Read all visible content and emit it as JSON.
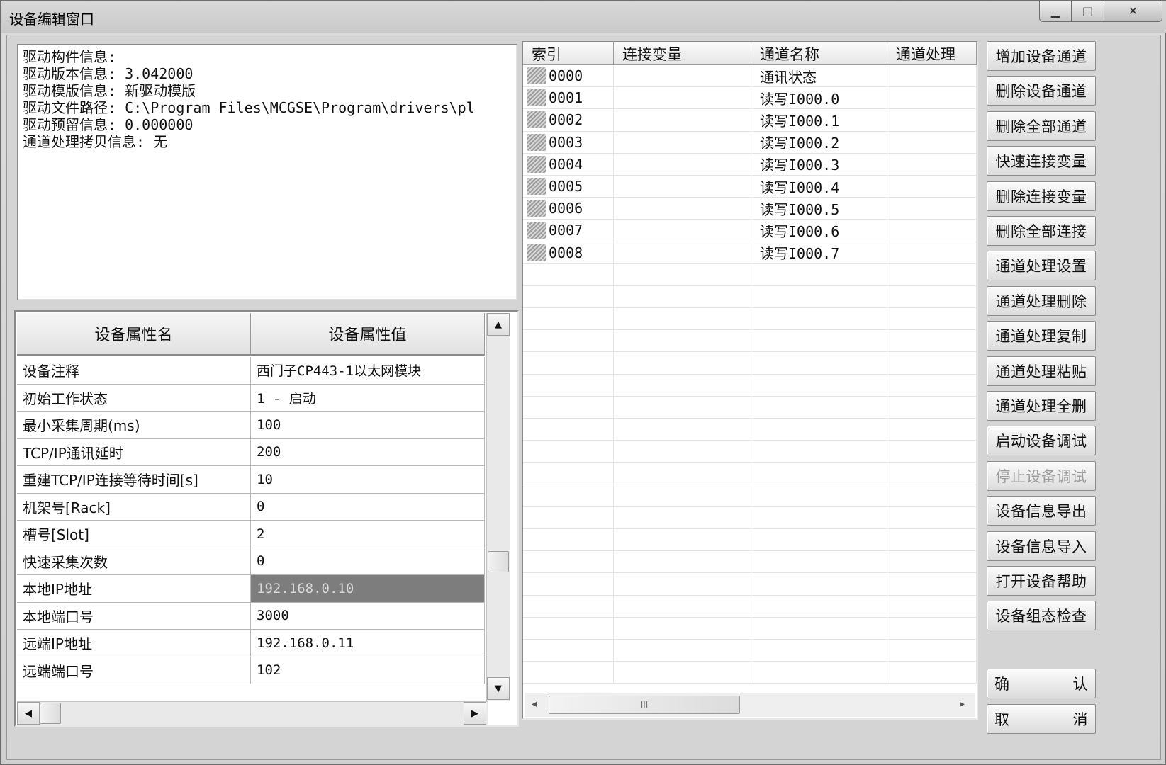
{
  "window": {
    "title": "设备编辑窗口",
    "controls": {
      "minimize": "▁",
      "maximize": "□",
      "close": "✕"
    }
  },
  "info": {
    "lines": [
      "驱动构件信息:",
      "驱动版本信息: 3.042000",
      "驱动模版信息: 新驱动模版",
      "驱动文件路径: C:\\Program Files\\MCGSE\\Program\\drivers\\pl",
      "驱动预留信息: 0.000000",
      "通道处理拷贝信息: 无"
    ]
  },
  "properties": {
    "headers": {
      "name": "设备属性名",
      "value": "设备属性值"
    },
    "rows": [
      {
        "name": "设备注释",
        "value": "西门子CP443-1以太网模块"
      },
      {
        "name": "初始工作状态",
        "value": "1 - 启动"
      },
      {
        "name": "最小采集周期(ms)",
        "value": "100"
      },
      {
        "name": "TCP/IP通讯延时",
        "value": "200"
      },
      {
        "name": "重建TCP/IP连接等待时间[s]",
        "value": "10"
      },
      {
        "name": "机架号[Rack]",
        "value": "0"
      },
      {
        "name": "槽号[Slot]",
        "value": "2"
      },
      {
        "name": "快速采集次数",
        "value": "0"
      },
      {
        "name": "本地IP地址",
        "value": "192.168.0.10"
      },
      {
        "name": "本地端口号",
        "value": "3000"
      },
      {
        "name": "远端IP地址",
        "value": "192.168.0.11"
      },
      {
        "name": "远端端口号",
        "value": "102"
      }
    ],
    "selected_row": 8,
    "scroll_icons": {
      "up": "▲",
      "down": "▼",
      "left": "◀",
      "right": "▶"
    }
  },
  "channels": {
    "headers": [
      "索引",
      "连接变量",
      "通道名称",
      "通道处理"
    ],
    "rows": [
      {
        "index": "0000",
        "variable": "",
        "name": "通讯状态",
        "process": ""
      },
      {
        "index": "0001",
        "variable": "",
        "name": "读写I000.0",
        "process": ""
      },
      {
        "index": "0002",
        "variable": "",
        "name": "读写I000.1",
        "process": ""
      },
      {
        "index": "0003",
        "variable": "",
        "name": "读写I000.2",
        "process": ""
      },
      {
        "index": "0004",
        "variable": "",
        "name": "读写I000.3",
        "process": ""
      },
      {
        "index": "0005",
        "variable": "",
        "name": "读写I000.4",
        "process": ""
      },
      {
        "index": "0006",
        "variable": "",
        "name": "读写I000.5",
        "process": ""
      },
      {
        "index": "0007",
        "variable": "",
        "name": "读写I000.6",
        "process": ""
      },
      {
        "index": "0008",
        "variable": "",
        "name": "读写I000.7",
        "process": ""
      }
    ],
    "scroll_icons": {
      "left": "◂",
      "right": "▸",
      "thumb": "III"
    }
  },
  "buttons": [
    {
      "label": "增加设备通道",
      "enabled": true
    },
    {
      "label": "删除设备通道",
      "enabled": true
    },
    {
      "label": "删除全部通道",
      "enabled": true
    },
    {
      "label": "快速连接变量",
      "enabled": true
    },
    {
      "label": "删除连接变量",
      "enabled": true
    },
    {
      "label": "删除全部连接",
      "enabled": true
    },
    {
      "label": "通道处理设置",
      "enabled": true
    },
    {
      "label": "通道处理删除",
      "enabled": true
    },
    {
      "label": "通道处理复制",
      "enabled": true
    },
    {
      "label": "通道处理粘贴",
      "enabled": true
    },
    {
      "label": "通道处理全删",
      "enabled": true
    },
    {
      "label": "启动设备调试",
      "enabled": true
    },
    {
      "label": "停止设备调试",
      "enabled": false
    },
    {
      "label": "设备信息导出",
      "enabled": true
    },
    {
      "label": "设备信息导入",
      "enabled": true
    },
    {
      "label": "打开设备帮助",
      "enabled": true
    },
    {
      "label": "设备组态检查",
      "enabled": true
    }
  ],
  "confirm_button": {
    "left": "确",
    "right": "认"
  },
  "cancel_button": {
    "left": "取",
    "right": "消"
  }
}
